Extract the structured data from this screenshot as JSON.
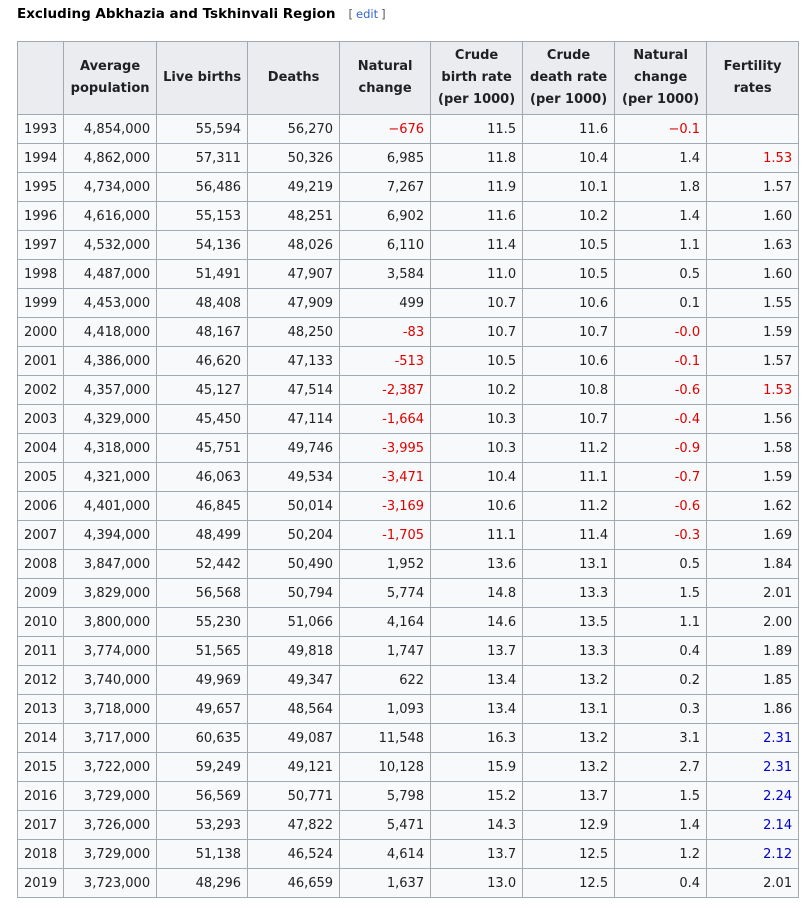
{
  "section": {
    "title": "Excluding Abkhazia and Tskhinvali Region",
    "edit_open": "[",
    "edit_label": "edit",
    "edit_close": "]"
  },
  "table": {
    "columns": [
      "",
      "Average population",
      "Live births",
      "Deaths",
      "Natural change",
      "Crude birth rate (per 1000)",
      "Crude death rate (per 1000)",
      "Natural change (per 1000)",
      "Fertility rates"
    ],
    "colors": {
      "negative": "#dd0000",
      "fertility_low": "#dd0000",
      "fertility_high": "#0000cc"
    },
    "rows": [
      {
        "year": "1993",
        "population": "4,854,000",
        "births": "55,594",
        "deaths": "56,270",
        "natural_change": "−676",
        "cbr": "11.5",
        "cdr": "11.6",
        "nc_rate": "−0.1",
        "fertility": "",
        "nc_neg": true,
        "ncr_neg": true,
        "fert_style": ""
      },
      {
        "year": "1994",
        "population": "4,862,000",
        "births": "57,311",
        "deaths": "50,326",
        "natural_change": "6,985",
        "cbr": "11.8",
        "cdr": "10.4",
        "nc_rate": "1.4",
        "fertility": "1.53",
        "nc_neg": false,
        "ncr_neg": false,
        "fert_style": "low"
      },
      {
        "year": "1995",
        "population": "4,734,000",
        "births": "56,486",
        "deaths": "49,219",
        "natural_change": "7,267",
        "cbr": "11.9",
        "cdr": "10.1",
        "nc_rate": "1.8",
        "fertility": "1.57",
        "nc_neg": false,
        "ncr_neg": false,
        "fert_style": ""
      },
      {
        "year": "1996",
        "population": "4,616,000",
        "births": "55,153",
        "deaths": "48,251",
        "natural_change": "6,902",
        "cbr": "11.6",
        "cdr": "10.2",
        "nc_rate": "1.4",
        "fertility": "1.60",
        "nc_neg": false,
        "ncr_neg": false,
        "fert_style": ""
      },
      {
        "year": "1997",
        "population": "4,532,000",
        "births": "54,136",
        "deaths": "48,026",
        "natural_change": "6,110",
        "cbr": "11.4",
        "cdr": "10.5",
        "nc_rate": "1.1",
        "fertility": "1.63",
        "nc_neg": false,
        "ncr_neg": false,
        "fert_style": ""
      },
      {
        "year": "1998",
        "population": "4,487,000",
        "births": "51,491",
        "deaths": "47,907",
        "natural_change": "3,584",
        "cbr": "11.0",
        "cdr": "10.5",
        "nc_rate": "0.5",
        "fertility": "1.60",
        "nc_neg": false,
        "ncr_neg": false,
        "fert_style": ""
      },
      {
        "year": "1999",
        "population": "4,453,000",
        "births": "48,408",
        "deaths": "47,909",
        "natural_change": "499",
        "cbr": "10.7",
        "cdr": "10.6",
        "nc_rate": "0.1",
        "fertility": "1.55",
        "nc_neg": false,
        "ncr_neg": false,
        "fert_style": ""
      },
      {
        "year": "2000",
        "population": "4,418,000",
        "births": "48,167",
        "deaths": "48,250",
        "natural_change": "-83",
        "cbr": "10.7",
        "cdr": "10.7",
        "nc_rate": "-0.0",
        "fertility": "1.59",
        "nc_neg": true,
        "ncr_neg": true,
        "fert_style": ""
      },
      {
        "year": "2001",
        "population": "4,386,000",
        "births": "46,620",
        "deaths": "47,133",
        "natural_change": "-513",
        "cbr": "10.5",
        "cdr": "10.6",
        "nc_rate": "-0.1",
        "fertility": "1.57",
        "nc_neg": true,
        "ncr_neg": true,
        "fert_style": ""
      },
      {
        "year": "2002",
        "population": "4,357,000",
        "births": "45,127",
        "deaths": "47,514",
        "natural_change": "-2,387",
        "cbr": "10.2",
        "cdr": "10.8",
        "nc_rate": "-0.6",
        "fertility": "1.53",
        "nc_neg": true,
        "ncr_neg": true,
        "fert_style": "low"
      },
      {
        "year": "2003",
        "population": "4,329,000",
        "births": "45,450",
        "deaths": "47,114",
        "natural_change": "-1,664",
        "cbr": "10.3",
        "cdr": "10.7",
        "nc_rate": "-0.4",
        "fertility": "1.56",
        "nc_neg": true,
        "ncr_neg": true,
        "fert_style": ""
      },
      {
        "year": "2004",
        "population": "4,318,000",
        "births": "45,751",
        "deaths": "49,746",
        "natural_change": "-3,995",
        "cbr": "10.3",
        "cdr": "11.2",
        "nc_rate": "-0.9",
        "fertility": "1.58",
        "nc_neg": true,
        "ncr_neg": true,
        "fert_style": ""
      },
      {
        "year": "2005",
        "population": "4,321,000",
        "births": "46,063",
        "deaths": "49,534",
        "natural_change": "-3,471",
        "cbr": "10.4",
        "cdr": "11.1",
        "nc_rate": "-0.7",
        "fertility": "1.59",
        "nc_neg": true,
        "ncr_neg": true,
        "fert_style": ""
      },
      {
        "year": "2006",
        "population": "4,401,000",
        "births": "46,845",
        "deaths": "50,014",
        "natural_change": "-3,169",
        "cbr": "10.6",
        "cdr": "11.2",
        "nc_rate": "-0.6",
        "fertility": "1.62",
        "nc_neg": true,
        "ncr_neg": true,
        "fert_style": ""
      },
      {
        "year": "2007",
        "population": "4,394,000",
        "births": "48,499",
        "deaths": "50,204",
        "natural_change": "-1,705",
        "cbr": "11.1",
        "cdr": "11.4",
        "nc_rate": "-0.3",
        "fertility": "1.69",
        "nc_neg": true,
        "ncr_neg": true,
        "fert_style": ""
      },
      {
        "year": "2008",
        "population": "3,847,000",
        "births": "52,442",
        "deaths": "50,490",
        "natural_change": "1,952",
        "cbr": "13.6",
        "cdr": "13.1",
        "nc_rate": "0.5",
        "fertility": "1.84",
        "nc_neg": false,
        "ncr_neg": false,
        "fert_style": ""
      },
      {
        "year": "2009",
        "population": "3,829,000",
        "births": "56,568",
        "deaths": "50,794",
        "natural_change": "5,774",
        "cbr": "14.8",
        "cdr": "13.3",
        "nc_rate": "1.5",
        "fertility": "2.01",
        "nc_neg": false,
        "ncr_neg": false,
        "fert_style": ""
      },
      {
        "year": "2010",
        "population": "3,800,000",
        "births": "55,230",
        "deaths": "51,066",
        "natural_change": "4,164",
        "cbr": "14.6",
        "cdr": "13.5",
        "nc_rate": "1.1",
        "fertility": "2.00",
        "nc_neg": false,
        "ncr_neg": false,
        "fert_style": ""
      },
      {
        "year": "2011",
        "population": "3,774,000",
        "births": "51,565",
        "deaths": "49,818",
        "natural_change": "1,747",
        "cbr": "13.7",
        "cdr": "13.3",
        "nc_rate": "0.4",
        "fertility": "1.89",
        "nc_neg": false,
        "ncr_neg": false,
        "fert_style": ""
      },
      {
        "year": "2012",
        "population": "3,740,000",
        "births": "49,969",
        "deaths": "49,347",
        "natural_change": "622",
        "cbr": "13.4",
        "cdr": "13.2",
        "nc_rate": "0.2",
        "fertility": "1.85",
        "nc_neg": false,
        "ncr_neg": false,
        "fert_style": ""
      },
      {
        "year": "2013",
        "population": "3,718,000",
        "births": "49,657",
        "deaths": "48,564",
        "natural_change": "1,093",
        "cbr": "13.4",
        "cdr": "13.1",
        "nc_rate": "0.3",
        "fertility": "1.86",
        "nc_neg": false,
        "ncr_neg": false,
        "fert_style": ""
      },
      {
        "year": "2014",
        "population": "3,717,000",
        "births": "60,635",
        "deaths": "49,087",
        "natural_change": "11,548",
        "cbr": "16.3",
        "cdr": "13.2",
        "nc_rate": "3.1",
        "fertility": "2.31",
        "nc_neg": false,
        "ncr_neg": false,
        "fert_style": "high"
      },
      {
        "year": "2015",
        "population": "3,722,000",
        "births": "59,249",
        "deaths": "49,121",
        "natural_change": "10,128",
        "cbr": "15.9",
        "cdr": "13.2",
        "nc_rate": "2.7",
        "fertility": "2.31",
        "nc_neg": false,
        "ncr_neg": false,
        "fert_style": "high"
      },
      {
        "year": "2016",
        "population": "3,729,000",
        "births": "56,569",
        "deaths": "50,771",
        "natural_change": "5,798",
        "cbr": "15.2",
        "cdr": "13.7",
        "nc_rate": "1.5",
        "fertility": "2.24",
        "nc_neg": false,
        "ncr_neg": false,
        "fert_style": "high"
      },
      {
        "year": "2017",
        "population": "3,726,000",
        "births": "53,293",
        "deaths": "47,822",
        "natural_change": "5,471",
        "cbr": "14.3",
        "cdr": "12.9",
        "nc_rate": "1.4",
        "fertility": "2.14",
        "nc_neg": false,
        "ncr_neg": false,
        "fert_style": "high"
      },
      {
        "year": "2018",
        "population": "3,729,000",
        "births": "51,138",
        "deaths": "46,524",
        "natural_change": "4,614",
        "cbr": "13.7",
        "cdr": "12.5",
        "nc_rate": "1.2",
        "fertility": "2.12",
        "nc_neg": false,
        "ncr_neg": false,
        "fert_style": "high"
      },
      {
        "year": "2019",
        "population": "3,723,000",
        "births": "48,296",
        "deaths": "46,659",
        "natural_change": "1,637",
        "cbr": "13.0",
        "cdr": "12.5",
        "nc_rate": "0.4",
        "fertility": "2.01",
        "nc_neg": false,
        "ncr_neg": false,
        "fert_style": ""
      }
    ]
  }
}
